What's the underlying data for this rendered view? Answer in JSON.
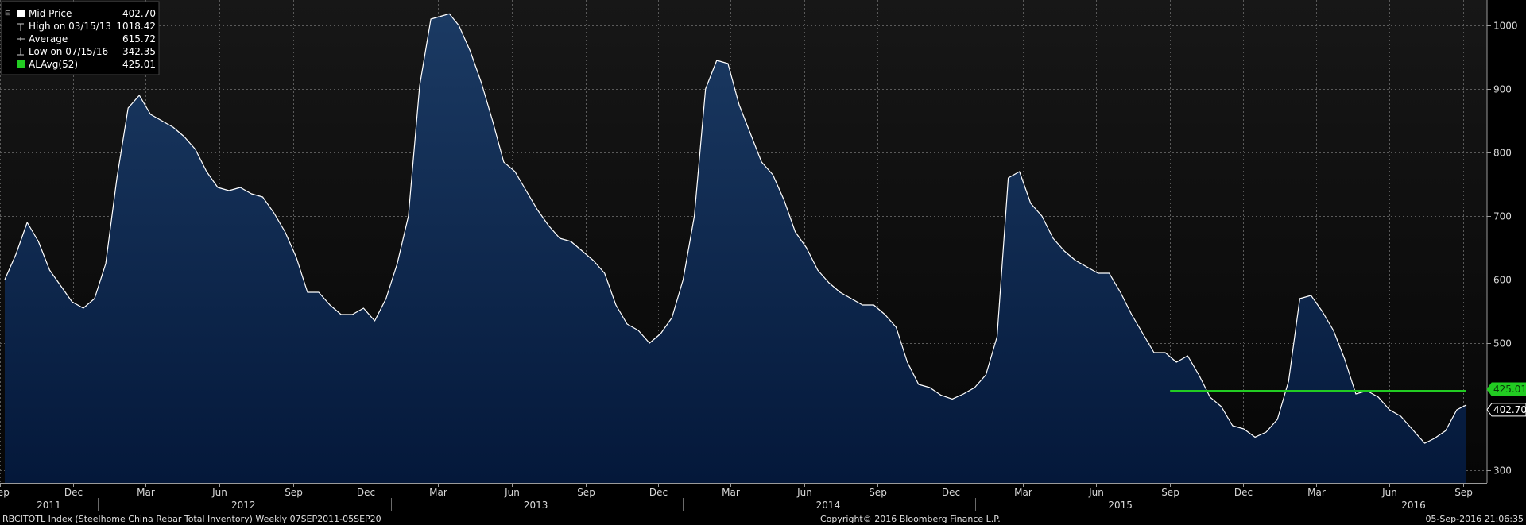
{
  "legend": {
    "items": [
      {
        "icon": "square-icon",
        "label": "Mid Price",
        "value": "402.70"
      },
      {
        "icon": "high-marker-icon",
        "label": "High on 03/15/13",
        "value": "1018.42"
      },
      {
        "icon": "average-marker-icon",
        "label": "Average",
        "value": "615.72"
      },
      {
        "icon": "low-marker-icon",
        "label": "Low on 07/15/16",
        "value": "342.35"
      },
      {
        "icon": "green-square-icon",
        "label": "ALAvg(52)",
        "value": "425.01"
      }
    ]
  },
  "footer": {
    "left": "RBCITOTL Index (Steelhome China Rebar Total Inventory)  Weekly 07SEP2011-05SEP20",
    "center": "Copyright© 2016 Bloomberg Finance L.P.",
    "right": "05-Sep-2016 21:06:35"
  },
  "colors": {
    "background": "#000000",
    "plot_background_top": "#171717",
    "plot_background_bottom": "#060606",
    "area_top": "#1b3a63",
    "area_bottom": "#04183a",
    "line": "#ffffff",
    "avg_line": "#22cc22",
    "grid": "#5a5a5a",
    "last_value_tag": "#ffffff",
    "avg_tag": "#22cc22"
  },
  "chart_data": {
    "type": "area",
    "ylim": [
      280,
      1040
    ],
    "yticks": [
      300,
      400,
      500,
      600,
      700,
      800,
      900,
      1000
    ],
    "x_range": [
      "2011-09-07",
      "2016-09-05"
    ],
    "month_ticks": [
      {
        "date": "2011-09-01",
        "label": "Sep"
      },
      {
        "date": "2011-12-01",
        "label": "Dec"
      },
      {
        "date": "2012-03-01",
        "label": "Mar"
      },
      {
        "date": "2012-06-01",
        "label": "Jun"
      },
      {
        "date": "2012-09-01",
        "label": "Sep"
      },
      {
        "date": "2012-12-01",
        "label": "Dec"
      },
      {
        "date": "2013-03-01",
        "label": "Mar"
      },
      {
        "date": "2013-06-01",
        "label": "Jun"
      },
      {
        "date": "2013-09-01",
        "label": "Sep"
      },
      {
        "date": "2013-12-01",
        "label": "Dec"
      },
      {
        "date": "2014-03-01",
        "label": "Mar"
      },
      {
        "date": "2014-06-01",
        "label": "Jun"
      },
      {
        "date": "2014-09-01",
        "label": "Sep"
      },
      {
        "date": "2014-12-01",
        "label": "Dec"
      },
      {
        "date": "2015-03-01",
        "label": "Mar"
      },
      {
        "date": "2015-06-01",
        "label": "Jun"
      },
      {
        "date": "2015-09-01",
        "label": "Sep"
      },
      {
        "date": "2015-12-01",
        "label": "Dec"
      },
      {
        "date": "2016-03-01",
        "label": "Mar"
      },
      {
        "date": "2016-06-01",
        "label": "Jun"
      },
      {
        "date": "2016-09-01",
        "label": "Sep"
      }
    ],
    "year_labels": [
      {
        "date": "2011-11-01",
        "label": "2011"
      },
      {
        "date": "2012-07-01",
        "label": "2012"
      },
      {
        "date": "2013-07-01",
        "label": "2013"
      },
      {
        "date": "2014-07-01",
        "label": "2014"
      },
      {
        "date": "2015-07-01",
        "label": "2015"
      },
      {
        "date": "2016-07-01",
        "label": "2016"
      }
    ],
    "year_separators": [
      "2012-01-01",
      "2013-01-01",
      "2014-01-01",
      "2015-01-01",
      "2016-01-01"
    ],
    "series": [
      {
        "name": "Mid Price",
        "points": [
          [
            "2011-09-07",
            600
          ],
          [
            "2011-09-21",
            640
          ],
          [
            "2011-10-05",
            690
          ],
          [
            "2011-10-19",
            660
          ],
          [
            "2011-11-02",
            615
          ],
          [
            "2011-11-16",
            590
          ],
          [
            "2011-11-30",
            565
          ],
          [
            "2011-12-14",
            555
          ],
          [
            "2011-12-28",
            570
          ],
          [
            "2012-01-11",
            625
          ],
          [
            "2012-01-25",
            760
          ],
          [
            "2012-02-08",
            870
          ],
          [
            "2012-02-22",
            890
          ],
          [
            "2012-03-07",
            860
          ],
          [
            "2012-03-21",
            850
          ],
          [
            "2012-04-04",
            840
          ],
          [
            "2012-04-18",
            825
          ],
          [
            "2012-05-02",
            805
          ],
          [
            "2012-05-16",
            770
          ],
          [
            "2012-05-30",
            745
          ],
          [
            "2012-06-13",
            740
          ],
          [
            "2012-06-27",
            745
          ],
          [
            "2012-07-11",
            735
          ],
          [
            "2012-07-25",
            730
          ],
          [
            "2012-08-08",
            705
          ],
          [
            "2012-08-22",
            675
          ],
          [
            "2012-09-05",
            635
          ],
          [
            "2012-09-19",
            580
          ],
          [
            "2012-10-03",
            580
          ],
          [
            "2012-10-17",
            560
          ],
          [
            "2012-10-31",
            545
          ],
          [
            "2012-11-14",
            545
          ],
          [
            "2012-11-28",
            555
          ],
          [
            "2012-12-12",
            535
          ],
          [
            "2012-12-26",
            570
          ],
          [
            "2013-01-09",
            625
          ],
          [
            "2013-01-23",
            700
          ],
          [
            "2013-02-06",
            905
          ],
          [
            "2013-02-20",
            1010
          ],
          [
            "2013-03-06",
            1015
          ],
          [
            "2013-03-15",
            1018.42
          ],
          [
            "2013-03-27",
            1000
          ],
          [
            "2013-04-10",
            960
          ],
          [
            "2013-04-24",
            910
          ],
          [
            "2013-05-08",
            850
          ],
          [
            "2013-05-22",
            785
          ],
          [
            "2013-06-05",
            770
          ],
          [
            "2013-06-19",
            740
          ],
          [
            "2013-07-03",
            710
          ],
          [
            "2013-07-17",
            685
          ],
          [
            "2013-07-31",
            665
          ],
          [
            "2013-08-14",
            660
          ],
          [
            "2013-08-28",
            645
          ],
          [
            "2013-09-11",
            630
          ],
          [
            "2013-09-25",
            610
          ],
          [
            "2013-10-09",
            560
          ],
          [
            "2013-10-23",
            530
          ],
          [
            "2013-11-06",
            520
          ],
          [
            "2013-11-20",
            500
          ],
          [
            "2013-12-04",
            515
          ],
          [
            "2013-12-18",
            540
          ],
          [
            "2014-01-01",
            600
          ],
          [
            "2014-01-15",
            700
          ],
          [
            "2014-01-29",
            900
          ],
          [
            "2014-02-12",
            945
          ],
          [
            "2014-02-26",
            940
          ],
          [
            "2014-03-12",
            875
          ],
          [
            "2014-03-26",
            830
          ],
          [
            "2014-04-09",
            785
          ],
          [
            "2014-04-23",
            765
          ],
          [
            "2014-05-07",
            725
          ],
          [
            "2014-05-21",
            675
          ],
          [
            "2014-06-04",
            650
          ],
          [
            "2014-06-18",
            615
          ],
          [
            "2014-07-02",
            595
          ],
          [
            "2014-07-16",
            580
          ],
          [
            "2014-07-30",
            570
          ],
          [
            "2014-08-13",
            560
          ],
          [
            "2014-08-27",
            560
          ],
          [
            "2014-09-10",
            545
          ],
          [
            "2014-09-24",
            525
          ],
          [
            "2014-10-08",
            470
          ],
          [
            "2014-10-22",
            435
          ],
          [
            "2014-11-05",
            430
          ],
          [
            "2014-11-19",
            418
          ],
          [
            "2014-12-03",
            412
          ],
          [
            "2014-12-17",
            420
          ],
          [
            "2014-12-31",
            430
          ],
          [
            "2015-01-14",
            450
          ],
          [
            "2015-01-28",
            510
          ],
          [
            "2015-02-11",
            760
          ],
          [
            "2015-02-25",
            770
          ],
          [
            "2015-03-11",
            720
          ],
          [
            "2015-03-25",
            700
          ],
          [
            "2015-04-08",
            665
          ],
          [
            "2015-04-22",
            645
          ],
          [
            "2015-05-06",
            630
          ],
          [
            "2015-05-20",
            620
          ],
          [
            "2015-06-03",
            610
          ],
          [
            "2015-06-17",
            610
          ],
          [
            "2015-07-01",
            580
          ],
          [
            "2015-07-15",
            545
          ],
          [
            "2015-07-29",
            515
          ],
          [
            "2015-08-12",
            485
          ],
          [
            "2015-08-26",
            485
          ],
          [
            "2015-09-09",
            470
          ],
          [
            "2015-09-23",
            480
          ],
          [
            "2015-10-07",
            450
          ],
          [
            "2015-10-21",
            415
          ],
          [
            "2015-11-04",
            400
          ],
          [
            "2015-11-18",
            370
          ],
          [
            "2015-12-02",
            365
          ],
          [
            "2015-12-16",
            352
          ],
          [
            "2015-12-30",
            360
          ],
          [
            "2016-01-13",
            380
          ],
          [
            "2016-01-27",
            440
          ],
          [
            "2016-02-10",
            570
          ],
          [
            "2016-02-24",
            575
          ],
          [
            "2016-03-09",
            550
          ],
          [
            "2016-03-23",
            520
          ],
          [
            "2016-04-06",
            475
          ],
          [
            "2016-04-20",
            420
          ],
          [
            "2016-05-04",
            425
          ],
          [
            "2016-05-18",
            415
          ],
          [
            "2016-06-01",
            395
          ],
          [
            "2016-06-15",
            385
          ],
          [
            "2016-06-29",
            365
          ],
          [
            "2016-07-15",
            342.35
          ],
          [
            "2016-07-27",
            350
          ],
          [
            "2016-08-10",
            362
          ],
          [
            "2016-08-24",
            395
          ],
          [
            "2016-09-05",
            402.7
          ]
        ]
      },
      {
        "name": "ALAvg(52)",
        "points": [
          [
            "2015-09-01",
            425.01
          ],
          [
            "2016-09-05",
            425.01
          ]
        ]
      }
    ],
    "last_value_tags": [
      {
        "series": "ALAvg(52)",
        "value": "425.01"
      },
      {
        "series": "Mid Price",
        "value": "402.70"
      }
    ]
  }
}
